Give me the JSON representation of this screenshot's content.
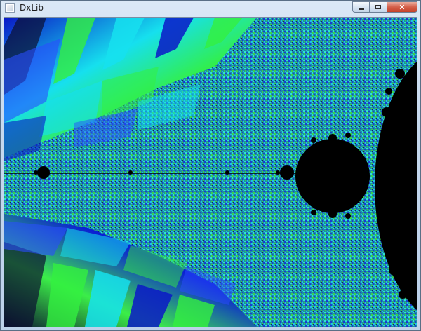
{
  "window": {
    "title": "DxLib",
    "buttons": {
      "minimize": "",
      "maximize": "",
      "close": "✕"
    }
  },
  "canvas": {
    "icon": "mandelbrot-fractal",
    "colors": {
      "set": "#000000",
      "deep_blue": "#0a18c8",
      "blue": "#2a4cff",
      "cyan": "#16e0ee",
      "green": "#33f040",
      "teal_noise": "#28b4b0",
      "dark": "#0b1030"
    }
  }
}
